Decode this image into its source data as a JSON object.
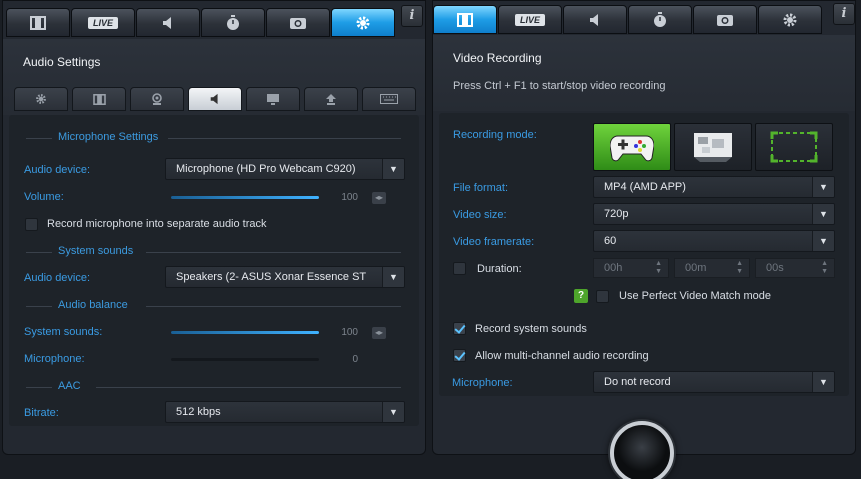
{
  "left_panel": {
    "tabs": [
      {
        "name": "video",
        "icon": "film-icon"
      },
      {
        "name": "live",
        "label": "LIVE"
      },
      {
        "name": "audio",
        "icon": "speaker-icon"
      },
      {
        "name": "timer",
        "icon": "stopwatch-icon"
      },
      {
        "name": "screenshot",
        "icon": "camera-icon"
      },
      {
        "name": "settings",
        "icon": "gear-icon",
        "active": true
      }
    ],
    "info": "i",
    "title": "Audio Settings",
    "subtabs": [
      "gear-icon",
      "film-icon",
      "webcam-icon",
      "speaker-icon",
      "monitor-icon",
      "upload-icon",
      "keyboard-icon"
    ],
    "active_subtab": 3,
    "microphone_settings": {
      "heading": "Microphone Settings",
      "audio_device_label": "Audio device:",
      "audio_device_value": "Microphone (HD Pro Webcam C920)",
      "volume_label": "Volume:",
      "volume_value": "100",
      "volume_level": 1.0,
      "separate_track_label": "Record microphone into separate audio track",
      "separate_track_checked": false
    },
    "system_sounds": {
      "heading": "System sounds",
      "audio_device_label": "Audio device:",
      "audio_device_value": "Speakers (2- ASUS Xonar Essence ST"
    },
    "audio_balance": {
      "heading": "Audio balance",
      "system_label": "System sounds:",
      "system_value": "100",
      "system_level": 1.0,
      "mic_label": "Microphone:",
      "mic_value": "0",
      "mic_level": 0.0
    },
    "aac": {
      "heading": "AAC",
      "bitrate_label": "Bitrate:",
      "bitrate_value": "512 kbps"
    }
  },
  "right_panel": {
    "tabs": [
      {
        "name": "video",
        "icon": "film-icon",
        "active": true
      },
      {
        "name": "live",
        "label": "LIVE"
      },
      {
        "name": "audio",
        "icon": "speaker-icon"
      },
      {
        "name": "timer",
        "icon": "stopwatch-icon"
      },
      {
        "name": "screenshot",
        "icon": "camera-icon"
      },
      {
        "name": "settings",
        "icon": "gear-icon"
      }
    ],
    "info": "i",
    "title": "Video Recording",
    "hint": "Press Ctrl + F1 to start/stop video recording",
    "recording_mode_label": "Recording mode:",
    "modes": [
      "gamepad-icon",
      "desktop-icon",
      "region-icon"
    ],
    "active_mode": 0,
    "file_format_label": "File format:",
    "file_format_value": "MP4 (AMD APP)",
    "video_size_label": "Video size:",
    "video_size_value": "720p",
    "framerate_label": "Video framerate:",
    "framerate_value": "60",
    "duration_label": "Duration:",
    "duration_checked": false,
    "duration_hours": "00h",
    "duration_minutes": "00m",
    "duration_seconds": "00s",
    "help_label": "?",
    "perfect_match_label": "Use Perfect Video Match mode",
    "perfect_match_checked": false,
    "record_system_label": "Record system sounds",
    "record_system_checked": true,
    "multichannel_label": "Allow multi-channel audio recording",
    "multichannel_checked": true,
    "microphone_label": "Microphone:",
    "microphone_value": "Do not record"
  },
  "colors": {
    "accent": "#1e9de6",
    "label_blue": "#3a9be3",
    "gamepad_green": "#4ea52b"
  }
}
